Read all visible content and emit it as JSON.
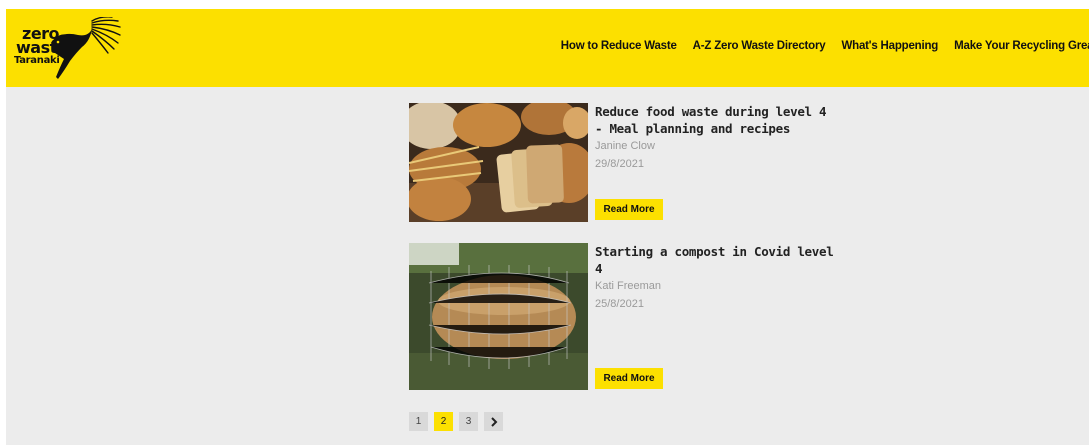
{
  "logo": {
    "line1": "zero",
    "line2": "waste",
    "line3": "Taranaki",
    "bird_icon": "fantail-bird-icon"
  },
  "nav": {
    "items": [
      {
        "label": "How to Reduce Waste"
      },
      {
        "label": "A-Z Zero Waste Directory"
      },
      {
        "label": "What's Happening"
      },
      {
        "label": "Make Your Recycling Great"
      }
    ]
  },
  "articles": [
    {
      "title": "Reduce food waste during level 4 - Meal planning and recipes",
      "author": "Janine Clow",
      "date": "29/8/2021",
      "read_more": "Read More",
      "image": "bread-photo"
    },
    {
      "title": "Starting a compost in Covid level 4",
      "author": "Kati Freeman",
      "date": "25/8/2021",
      "read_more": "Read More",
      "image": "compost-bin-photo"
    }
  ],
  "pagination": {
    "pages": [
      "1",
      "2",
      "3"
    ],
    "current": "2",
    "next_icon": "chevron-right-icon"
  },
  "colors": {
    "brand_yellow": "#fce000",
    "background": "#ececec",
    "muted_text": "#9a9a9a"
  }
}
